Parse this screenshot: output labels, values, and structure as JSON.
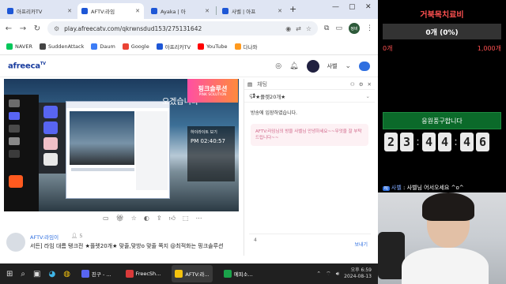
{
  "browser": {
    "tabs": [
      {
        "label": "아프리카TV",
        "active": false
      },
      {
        "label": "AFTV:라임",
        "active": true
      },
      {
        "label": "Ayaka | 아",
        "active": false
      },
      {
        "label": "사벨 | 아프",
        "active": false
      }
    ],
    "url": "play.afreecatv.com/qkrwnsdud153/275131642",
    "profile_label": "정비",
    "bookmarks": [
      "NAVER",
      "SuddenAttack",
      "Daum",
      "Google",
      "아프리카TV",
      "YouTube",
      "다나와"
    ]
  },
  "site": {
    "logo": "afreeca",
    "logo_suffix": "TV",
    "user_name": "사벨"
  },
  "player": {
    "overlay_text": "오겠습니다",
    "promo_title": "핑크솔루션",
    "promo_sub": "PINK SOLUTION",
    "right_panel_title": "하이라이트 보기",
    "right_panel_clock": "PM 02:40:57"
  },
  "stream": {
    "bj_name": "AFTV:라임이",
    "viewer_count": "5",
    "title": "서든] 라임 대름 탱크전 ★플렛20개★ 맞줄,맞방o 맞줄 쪽지 @최적화는 핑크솔루션"
  },
  "chat": {
    "header": "채팅",
    "notice": "★플렛20개★",
    "system_message": "방송에 입장하였습니다.",
    "welcome": "AFTV:라임님의 방을 사벨님 안녕하세요~~무엇을 잘 부탁드립니다~~",
    "input_placeholder": "4",
    "send_label": "보내기"
  },
  "overlay": {
    "title": "거북목치료비",
    "progress_label": "0개 (0%)",
    "progress_fraction": 0,
    "min_label": "0개",
    "max_label": "1,000개",
    "support_text": "응원풍구합니다",
    "timer_digits": [
      "2",
      "3",
      "4",
      "4",
      "4",
      "6"
    ],
    "chat_badge": "BJ",
    "chat_user": "사벨",
    "chat_message": ": 사벨님 어서오세요 ^o^"
  },
  "taskbar": {
    "apps": [
      "친구 - ...",
      "FreecSh...",
      "AFTV:라...",
      "에피소..."
    ],
    "time": "오후 6:59",
    "date": "2024-08-13"
  },
  "colors": {
    "accent": "#2f6fe0",
    "overlay_red": "#ff5151",
    "support_green": "#0b6a2a"
  }
}
